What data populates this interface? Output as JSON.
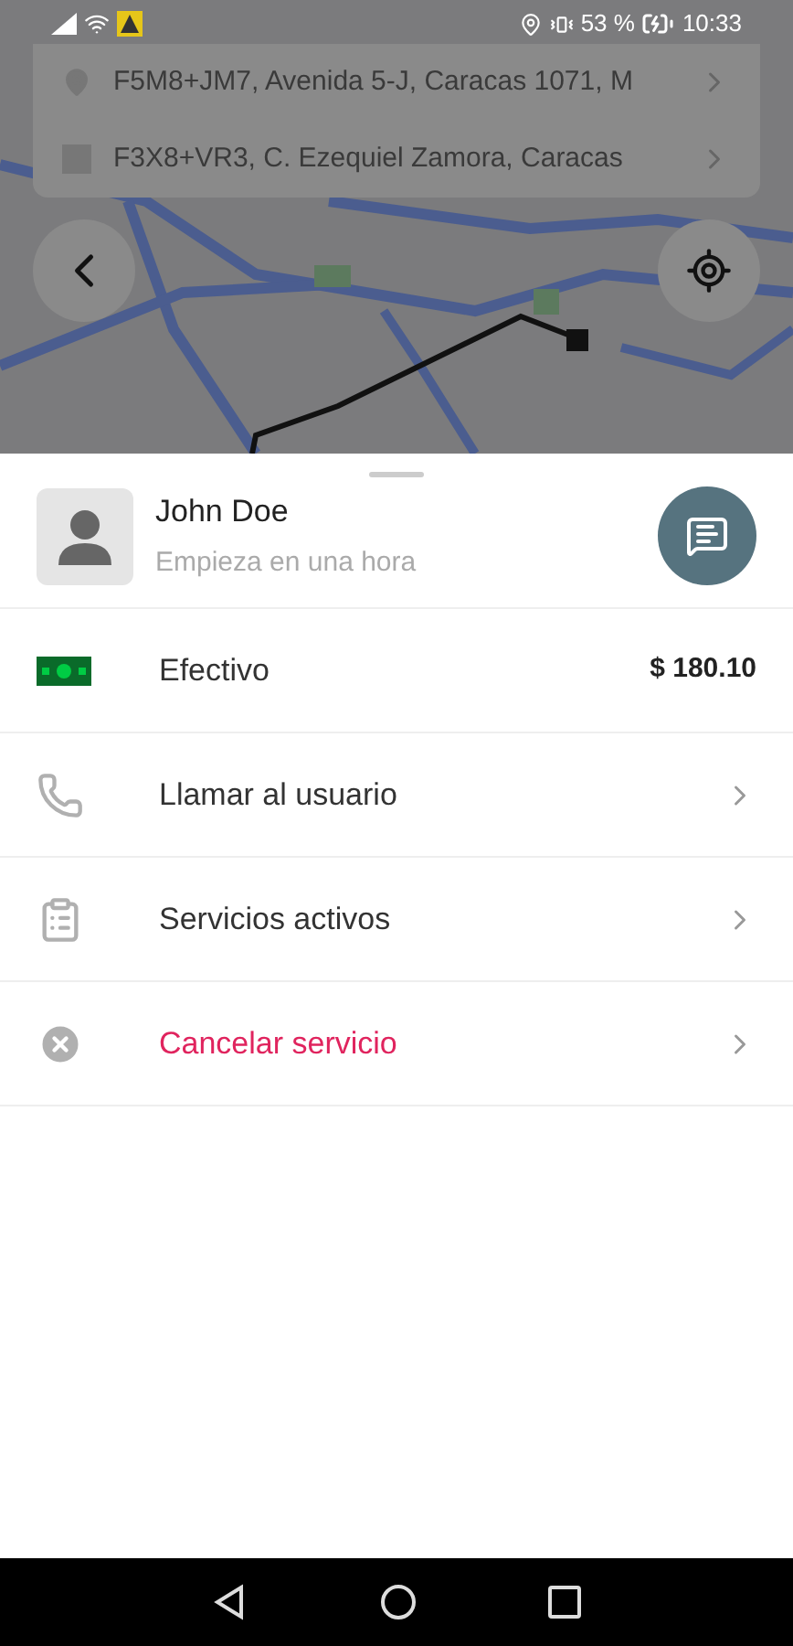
{
  "status_bar": {
    "battery": "53 %",
    "time": "10:33"
  },
  "route": [
    {
      "address": "F5M8+JM7, Avenida 5-J, Caracas 1071, M"
    },
    {
      "address": "F3X8+VR3, C. Ezequiel Zamora, Caracas"
    }
  ],
  "user": {
    "name": "John Doe",
    "subtitle": "Empieza en una hora"
  },
  "options": [
    {
      "kind": "payment",
      "label": "Efectivo",
      "amount": "$ 180.10"
    },
    {
      "kind": "action",
      "label": "Llamar al usuario"
    },
    {
      "kind": "action",
      "label": "Servicios activos"
    },
    {
      "kind": "danger",
      "label": "Cancelar servicio"
    }
  ]
}
